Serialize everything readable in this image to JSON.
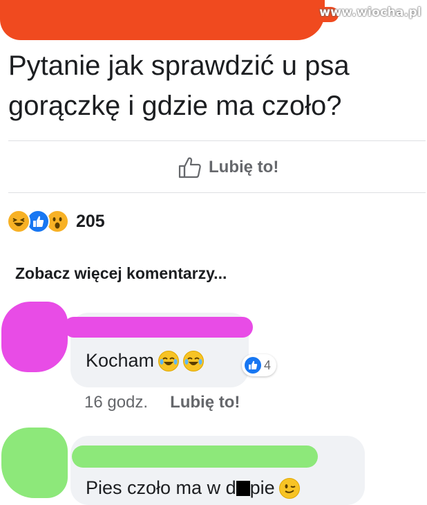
{
  "watermark": "www.wiocha.pl",
  "post": {
    "text_line1": "Pytanie jak sprawdzić u psa",
    "text_line2": "gorączkę i gdzie ma czoło?"
  },
  "actions": {
    "like_label": "Lubię to!"
  },
  "reactions": {
    "count": "205",
    "types": [
      "haha-icon",
      "like-icon",
      "wow-icon"
    ]
  },
  "comments_link": "Zobacz więcej komentarzy...",
  "comments": [
    {
      "text": "Kocham",
      "emoji": [
        "laughing-tears-icon",
        "laughing-tears-icon"
      ],
      "like_count": "4",
      "time": "16 godz.",
      "like_label": "Lubię to!"
    },
    {
      "text_before": "Pies czoło ma w d",
      "text_after": "pie",
      "emoji": [
        "wink-icon"
      ]
    }
  ],
  "colors": {
    "redaction_red": "#f04a1f",
    "redaction_pink": "#e84ce6",
    "redaction_green": "#8de87a",
    "facebook_blue": "#1877f2",
    "reaction_yellow": "#f7b125"
  }
}
